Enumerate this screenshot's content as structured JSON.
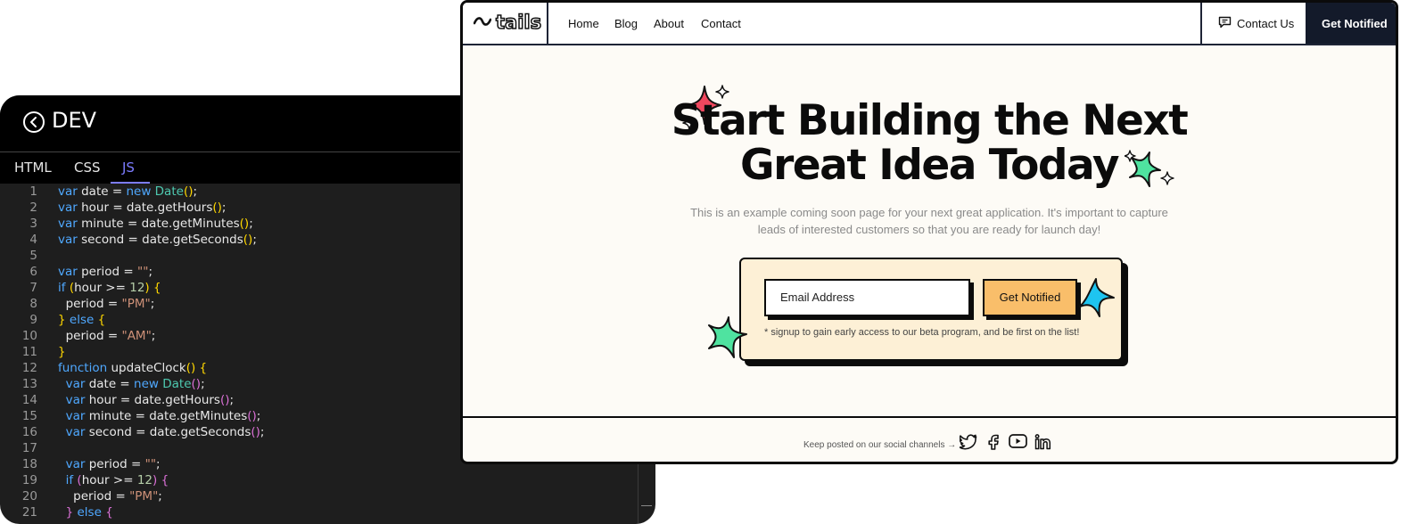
{
  "editor": {
    "title": "DEV",
    "tabs": [
      "HTML",
      "CSS",
      "JS"
    ],
    "active_tab": "JS",
    "line_numbers": [
      "1",
      "2",
      "3",
      "4",
      "5",
      "6",
      "7",
      "8",
      "9",
      "10",
      "11",
      "12",
      "13",
      "14",
      "15",
      "16",
      "17",
      "18",
      "19",
      "20",
      "21"
    ]
  },
  "site": {
    "logo": "tails",
    "nav": [
      "Home",
      "Blog",
      "About",
      "Contact"
    ],
    "contact_button": "Contact Us",
    "notify_button": "Get Notified",
    "hero_line1": "Start Building the Next",
    "hero_line2": "Great Idea Today",
    "subtitle_line1": "This is an example coming soon page for your next great application. It's important to capture",
    "subtitle_line2": "leads of interested customers so that you are ready for launch day!",
    "email_placeholder": "Email Address",
    "cta_button": "Get Notified",
    "note": "* signup to gain early access to our beta program, and be first on the list!",
    "footer_text": "Keep posted on our social channels →",
    "social_icons": [
      "twitter-icon",
      "facebook-icon",
      "youtube-icon",
      "linkedin-icon"
    ],
    "colors": {
      "accent_orange": "#f9be6a",
      "card_bg": "#fdf0d6",
      "sparkle_red": "#f0475e",
      "sparkle_green": "#4fe3a0",
      "sparkle_blue": "#1ec4f0",
      "dark": "#131a2a"
    }
  }
}
